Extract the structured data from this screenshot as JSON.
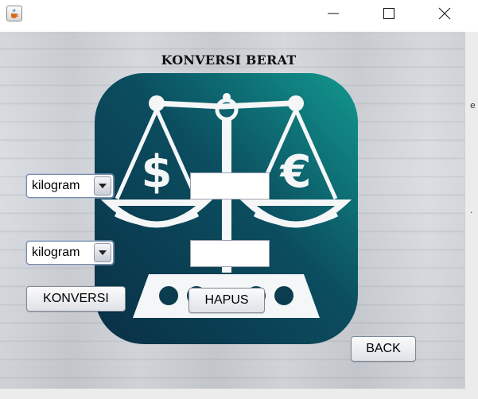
{
  "window": {
    "title": "",
    "controls": {
      "minimize": "minimize",
      "maximize": "maximize",
      "close": "close"
    }
  },
  "page": {
    "title": "KONVERSI BERAT"
  },
  "from_unit": {
    "selected": "kilogram"
  },
  "to_unit": {
    "selected": "kilogram"
  },
  "input_field": {
    "value": ""
  },
  "output_field": {
    "value": ""
  },
  "buttons": {
    "convert": "KONVERSI",
    "clear": "HAPUS",
    "back": "BACK"
  },
  "side_strip": {
    "glyph_top": "e",
    "glyph_bottom": "."
  },
  "logo": {
    "symbol_left": "$",
    "symbol_right": "€"
  },
  "colors": {
    "logo_dark": "#0b3c4f",
    "logo_teal": "#0d8a86",
    "background": "#d2d5da",
    "accent_border": "#7a8aa3"
  },
  "icons": {
    "app": "java-cup-icon",
    "combo_arrow": "triangle-down-icon"
  }
}
